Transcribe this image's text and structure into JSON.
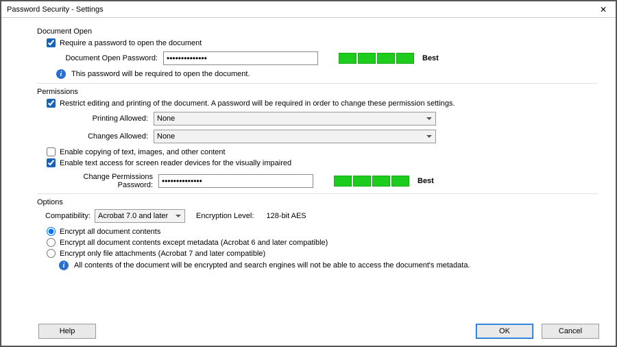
{
  "window": {
    "title": "Password Security - Settings"
  },
  "documentOpen": {
    "groupLabel": "Document Open",
    "requireLabel": "Require a password to open the document",
    "requireChecked": true,
    "passwordLabel": "Document Open Password:",
    "passwordValue": "••••••••••••••",
    "infoText": "This password will be required to open the document.",
    "strengthLabel": "Best"
  },
  "permissions": {
    "groupLabel": "Permissions",
    "restrictLabel": "Restrict editing and printing of the document. A password will be required in order to change these permission settings.",
    "restrictChecked": true,
    "printingLabel": "Printing Allowed:",
    "printingValue": "None",
    "changesLabel": "Changes Allowed:",
    "changesValue": "None",
    "copyLabel": "Enable copying of text, images, and other content",
    "copyChecked": false,
    "screenReaderLabel": "Enable text access for screen reader devices for the visually impaired",
    "screenReaderChecked": true,
    "changePwdLabel": "Change Permissions Password:",
    "changePwdValue": "••••••••••••••",
    "strengthLabel": "Best"
  },
  "options": {
    "groupLabel": "Options",
    "compatLabel": "Compatibility:",
    "compatValue": "Acrobat 7.0 and later",
    "encLevelLabel": "Encryption  Level:",
    "encLevelValue": "128-bit AES",
    "radio1": "Encrypt all document contents",
    "radio2": "Encrypt all document contents except metadata (Acrobat 6 and later compatible)",
    "radio3": "Encrypt only file attachments (Acrobat 7 and later compatible)",
    "radioSelected": 0,
    "infoText": "All contents of the document will be encrypted and search engines will not be able to access the document's metadata."
  },
  "buttons": {
    "help": "Help",
    "ok": "OK",
    "cancel": "Cancel"
  }
}
